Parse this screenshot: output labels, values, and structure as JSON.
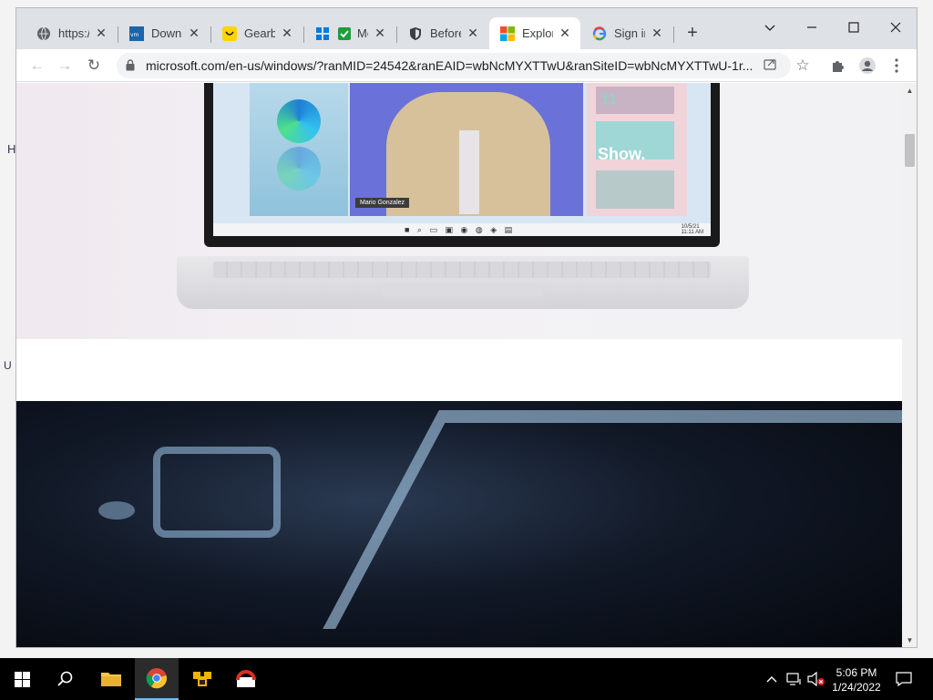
{
  "desktop": {
    "left_text_1": "H",
    "left_text_2": "U"
  },
  "browser": {
    "tabs": [
      {
        "title": "https://",
        "icon": "globe-icon"
      },
      {
        "title": "Downlo",
        "icon": "vmware-icon"
      },
      {
        "title": "Gearbe",
        "icon": "gearbest-icon"
      },
      {
        "title": "Mc",
        "icon": "windows-check-icon"
      },
      {
        "title": "Before",
        "icon": "shield-icon"
      },
      {
        "title": "Explore",
        "icon": "microsoft-logo-icon",
        "active": true
      },
      {
        "title": "Sign in",
        "icon": "google-icon"
      }
    ],
    "new_tab_label": "+",
    "window_controls": {
      "chevron": "⌄",
      "minimize": "—",
      "maximize": "☐",
      "close": "✕"
    },
    "toolbar": {
      "back": "←",
      "forward": "→",
      "reload": "↻",
      "url": "microsoft.com/en-us/windows/?ranMID=24542&ranEAID=wbNcMYXTTwU&ranSiteID=wbNcMYXTTwU-1r...",
      "bookmark": "☆"
    }
  },
  "page": {
    "name_tag": "Mario Gonzalez",
    "widget_text": "Show.",
    "widget_number": "11",
    "mini_clock_time": "11:11 AM",
    "mini_clock_date": "10/5/21"
  },
  "taskbar": {
    "apps": [
      {
        "name": "start-button",
        "icon": "windows-logo-icon"
      },
      {
        "name": "search-button",
        "icon": "search-icon"
      },
      {
        "name": "file-explorer-button",
        "icon": "folder-icon"
      },
      {
        "name": "chrome-button",
        "icon": "chrome-icon",
        "active": true
      },
      {
        "name": "app-yellow-button",
        "icon": "yellow-app-icon"
      },
      {
        "name": "app-red-button",
        "icon": "red-app-icon"
      }
    ],
    "time": "5:06 PM",
    "date": "1/24/2022"
  }
}
